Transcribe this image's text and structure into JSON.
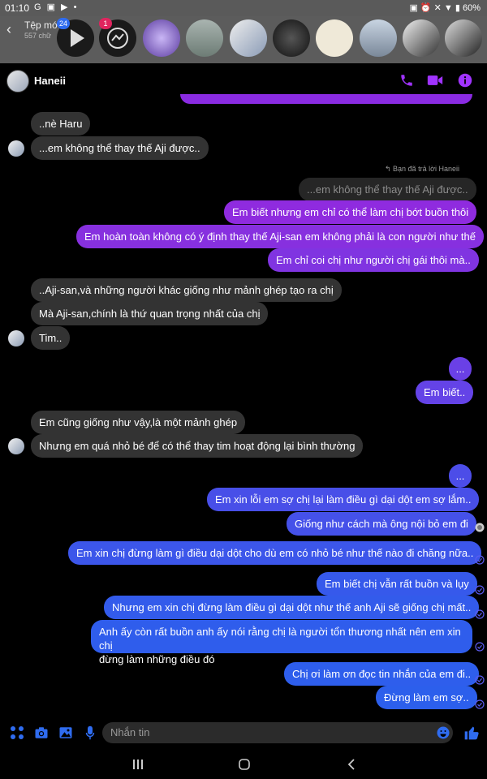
{
  "status": {
    "time": "01:10",
    "battery": "60%"
  },
  "top": {
    "back": "‹",
    "title": "Tệp mớ",
    "subtitle": "557 chữ",
    "badge1": "24",
    "badge2": "1"
  },
  "chat": {
    "name": "Haneii"
  },
  "replied_label": "↰ Bạn đã trả lời Haneii",
  "messages": [
    {
      "text": "..nè Haru",
      "side": "in"
    },
    {
      "text": "...em không thể thay thế Aji được..",
      "side": "in"
    },
    {
      "text": "...em không thể thay thế Aji được..",
      "side": "reply"
    },
    {
      "text": "Em biết nhưng em chỉ có thể làm chị bớt buồn thôi",
      "side": "out"
    },
    {
      "text": "Em hoàn toàn không có ý định thay thế Aji-san em không phải là con người như thế",
      "side": "out"
    },
    {
      "text": "Em chỉ coi chị như người chị gái thôi mà..",
      "side": "out"
    },
    {
      "text": "..Aji-san,và những người khác giống như mảnh ghép tạo ra chị",
      "side": "in"
    },
    {
      "text": "Mà Aji-san,chính là thứ quan trọng nhất của chị",
      "side": "in"
    },
    {
      "text": "Tim..",
      "side": "in"
    },
    {
      "text": "...",
      "side": "out"
    },
    {
      "text": "Em biết..",
      "side": "out"
    },
    {
      "text": "Em cũng giống như vậy,là một mảnh ghép",
      "side": "in"
    },
    {
      "text": "Nhưng em quá nhỏ bé để có thể thay tim hoạt động lại bình thường",
      "side": "in"
    },
    {
      "text": "...",
      "side": "out"
    },
    {
      "text": "Em xin lỗi em sợ chị lại làm điều gì dại dột em sợ lắm..",
      "side": "out"
    },
    {
      "text": "Giống như cách mà ông nội bỏ em đi",
      "side": "out"
    },
    {
      "text": "Em xin chị đừng làm gì điều dại dột cho dù em có nhỏ bé như thế nào đi chăng nữa..",
      "side": "out"
    },
    {
      "text": "Em biết chị vẫn rất buồn và lụy",
      "side": "out"
    },
    {
      "text": "Nhưng em xin chị đừng làm điều gì dại dột như thế anh Aji sẽ giống chị mất..",
      "side": "out"
    },
    {
      "text": "Anh ấy còn rất buồn anh ấy nói rằng chị là người tổn thương nhất nên em xin chị\nđừng làm những điều đó",
      "side": "out"
    },
    {
      "text": "Chị ơi làm ơn đọc tin nhắn của em đi..",
      "side": "out"
    },
    {
      "text": "Đừng làm em sợ..",
      "side": "out"
    }
  ],
  "composer": {
    "placeholder": "Nhắn tin"
  },
  "colors": {
    "accent": "#a033ff",
    "out_top": "#8a2be2",
    "out_bottom": "#2f5bea"
  }
}
